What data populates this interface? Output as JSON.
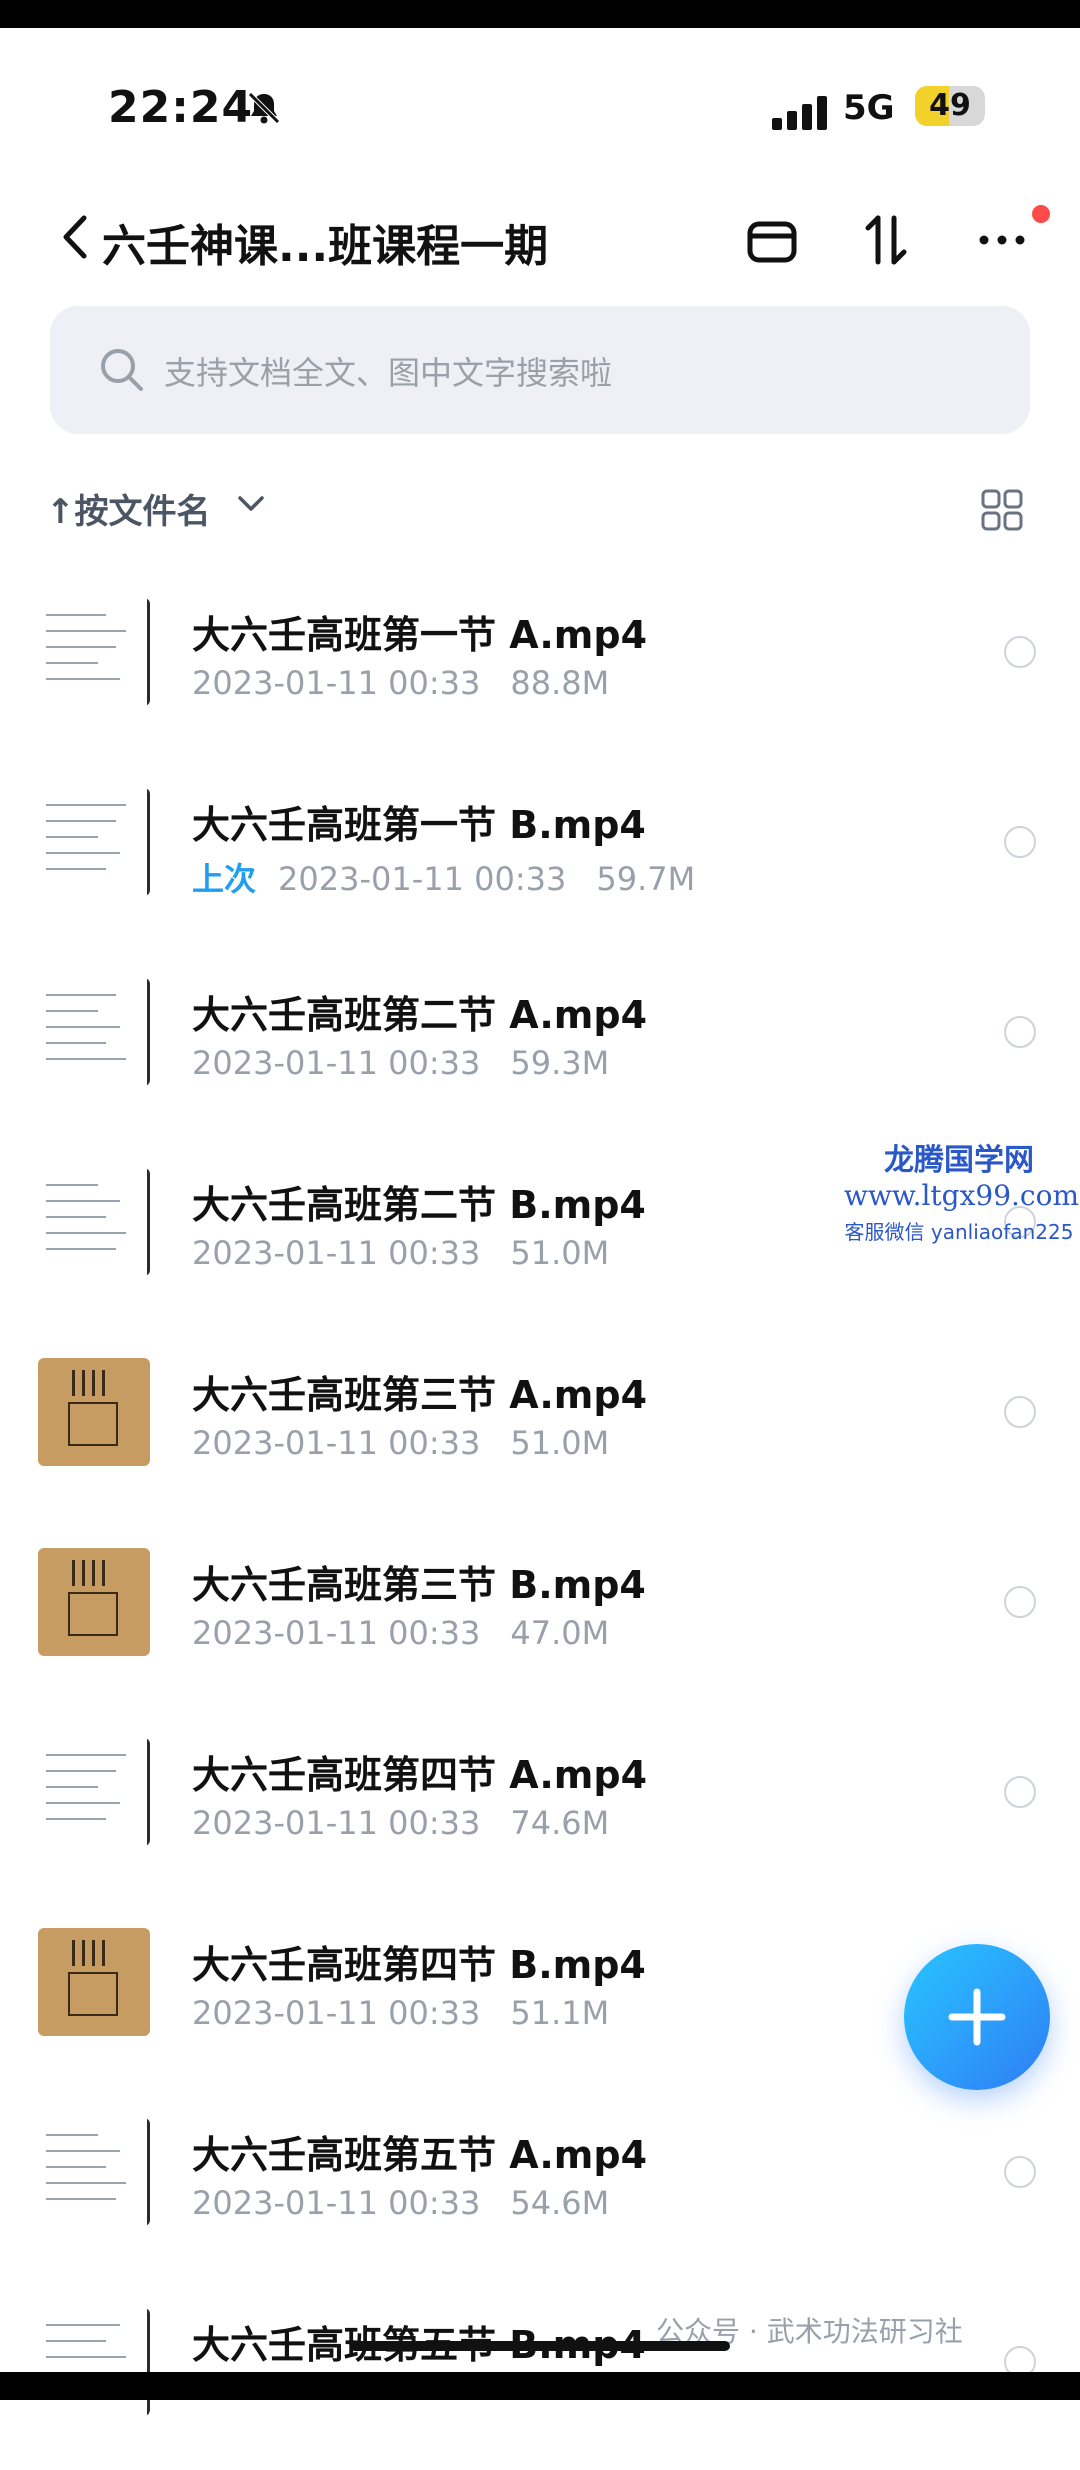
{
  "status_bar": {
    "time": "22:24",
    "network": "5G",
    "battery": "49",
    "battery_level": 0.49
  },
  "header": {
    "title": "六壬神课...班课程一期"
  },
  "search": {
    "placeholder": "支持文档全文、图中文字搜索啦"
  },
  "sort": {
    "label": "↑按文件名"
  },
  "files": [
    {
      "name": "大六壬高班第一节 A.mp4",
      "date": "2023-01-11 00:33",
      "size": "88.8M",
      "badge": ""
    },
    {
      "name": "大六壬高班第一节 B.mp4",
      "date": "2023-01-11 00:33",
      "size": "59.7M",
      "badge": "上次"
    },
    {
      "name": "大六壬高班第二节 A.mp4",
      "date": "2023-01-11 00:33",
      "size": "59.3M",
      "badge": ""
    },
    {
      "name": "大六壬高班第二节 B.mp4",
      "date": "2023-01-11 00:33",
      "size": "51.0M",
      "badge": ""
    },
    {
      "name": "大六壬高班第三节 A.mp4",
      "date": "2023-01-11 00:33",
      "size": "51.0M",
      "badge": ""
    },
    {
      "name": "大六壬高班第三节 B.mp4",
      "date": "2023-01-11 00:33",
      "size": "47.0M",
      "badge": ""
    },
    {
      "name": "大六壬高班第四节 A.mp4",
      "date": "2023-01-11 00:33",
      "size": "74.6M",
      "badge": ""
    },
    {
      "name": "大六壬高班第四节 B.mp4",
      "date": "2023-01-11 00:33",
      "size": "51.1M",
      "badge": ""
    },
    {
      "name": "大六壬高班第五节 A.mp4",
      "date": "2023-01-11 00:33",
      "size": "54.6M",
      "badge": ""
    },
    {
      "name": "大六壬高班第五节 B.mp4",
      "date": "",
      "size": "",
      "badge": ""
    }
  ],
  "watermark": {
    "line1": "龙腾国学网",
    "line2": "www.ltgx99.com",
    "line3": "客服微信 yanliaofan225"
  },
  "footer_watermark": "公众号 · 武术功法研习社",
  "icons": {
    "back": "chevron-left-icon",
    "mute": "bell-off-icon",
    "signal": "signal-bars-icon",
    "layout": "panel-icon",
    "sort_toggle": "sort-arrows-icon",
    "more": "more-dots-icon",
    "search": "search-icon",
    "view": "grid-view-icon",
    "add": "plus-icon"
  },
  "colors": {
    "accent": "#1f9ef2",
    "fab_start": "#28c6ff",
    "fab_end": "#2f7df5",
    "badge_dot": "#ff4a4a",
    "battery": "#f2d22a"
  }
}
